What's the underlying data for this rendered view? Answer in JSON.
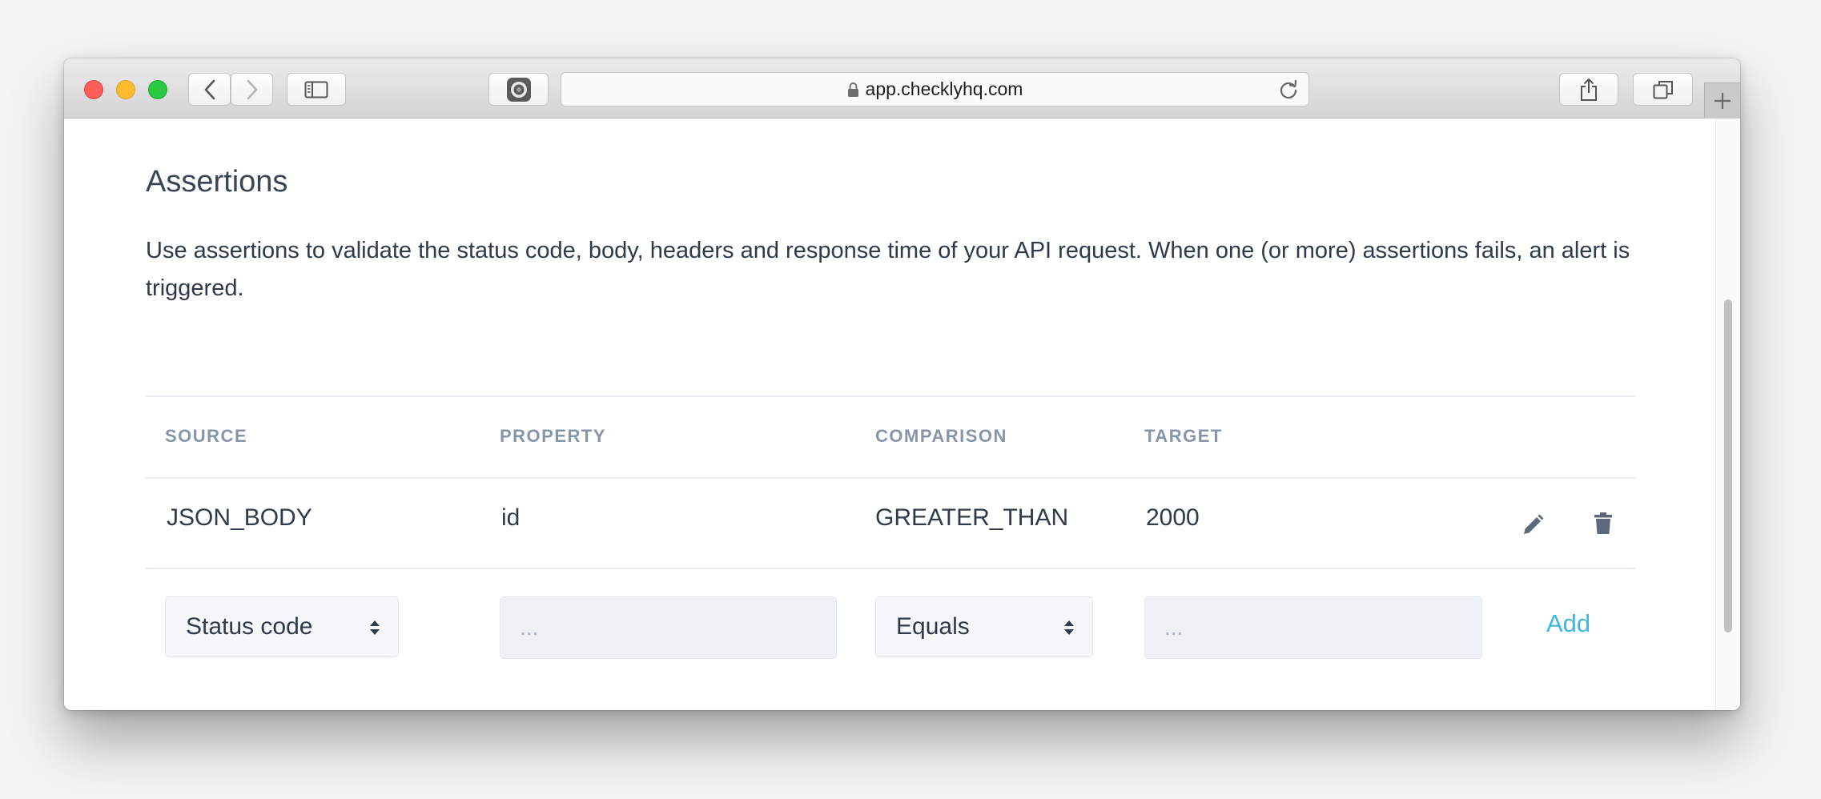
{
  "browser": {
    "url": "app.checklyhq.com",
    "icons": [
      "back-arrow-icon",
      "forward-arrow-icon",
      "sidebar-icon",
      "extension-icon",
      "lock-icon",
      "reload-icon",
      "share-icon",
      "tabs-icon",
      "plus-icon"
    ]
  },
  "assertions": {
    "title": "Assertions",
    "description": "Use assertions to validate the status code, body, headers and response time of your API request. When one (or more) assertions fails, an alert is triggered.",
    "columns": [
      "SOURCE",
      "PROPERTY",
      "COMPARISON",
      "TARGET"
    ],
    "rows": [
      {
        "source": "JSON_BODY",
        "property": "id",
        "comparison": "GREATER_THAN",
        "target": "2000"
      }
    ],
    "new_row": {
      "source_select": "Status code",
      "property_placeholder": "...",
      "comparison_select": "Equals",
      "target_placeholder": "...",
      "add_label": "Add"
    }
  },
  "colors": {
    "accent": "#3fb5e0",
    "heading_text": "#3a4656",
    "column_header_text": "#8795a8"
  }
}
